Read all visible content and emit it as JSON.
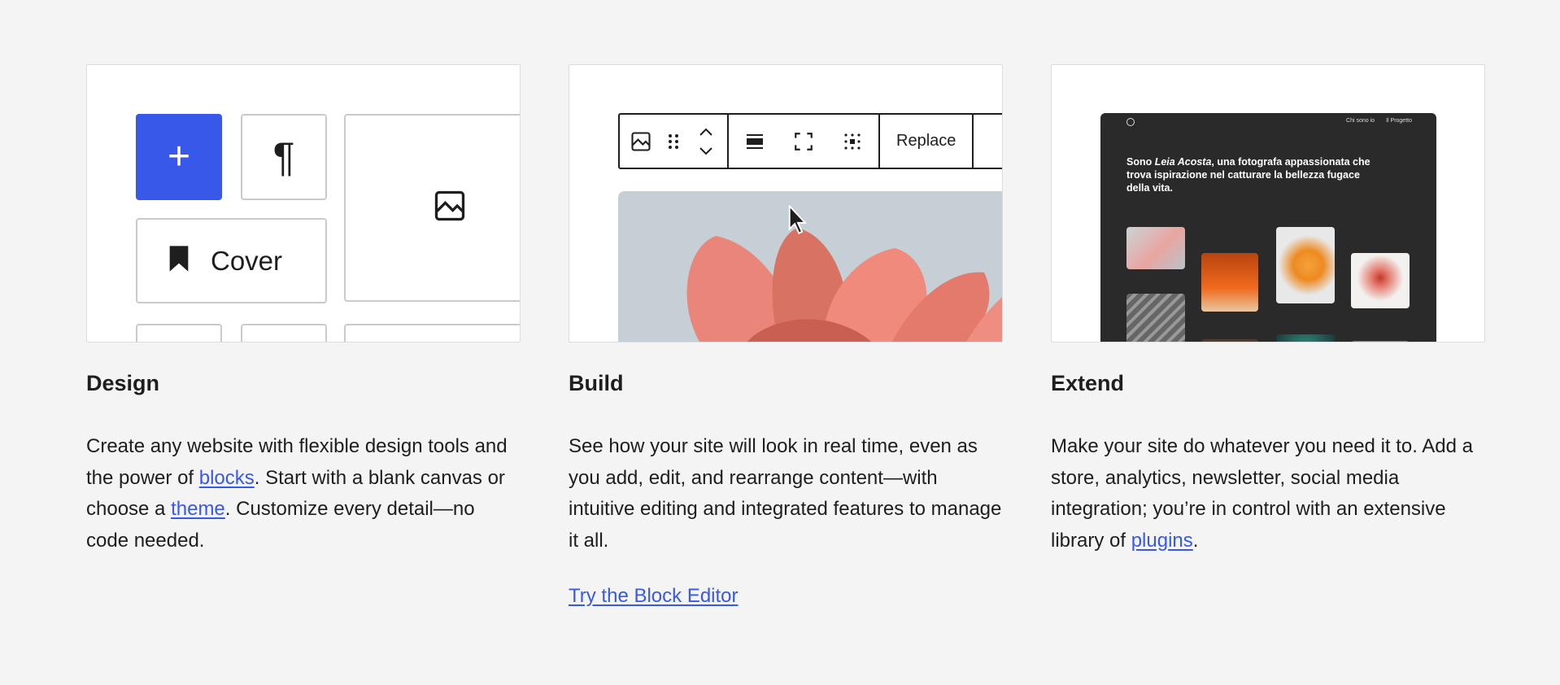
{
  "columns": [
    {
      "heading": "Design",
      "desc": {
        "p1": "Create any website with flexible design tools and the power of ",
        "link1": "blocks",
        "p2": ". Start with a blank canvas or choose a ",
        "link2": "theme",
        "p3": ". Customize every detail—no code needed."
      },
      "preview": {
        "cover_label": "Cover",
        "paragraph_glyph": "¶",
        "plus_glyph": "+",
        "accent": "#3858e9"
      }
    },
    {
      "heading": "Build",
      "desc": "See how your site will look in real time, even as you add, edit, and rearrange content—with intuitive editing and integrated features to manage it all.",
      "cta": "Try the Block Editor",
      "preview": {
        "toolbar_icons": [
          "image-icon",
          "drag-handle-icon",
          "move-up-down-icon",
          "align-icon",
          "fullscreen-icon",
          "grid-icon"
        ],
        "replace_label": "Replace"
      }
    },
    {
      "heading": "Extend",
      "desc": {
        "p1": "Make your site do whatever you need it to. Add a store, analytics, newsletter, social media integration; you’re in control with an extensive library of ",
        "link1": "plugins",
        "p2": "."
      },
      "preview": {
        "nav": [
          "Chi sono io",
          "Il Progetto"
        ],
        "intro": {
          "pre": "Sono ",
          "name": "Leia Acosta",
          "post": ", una fotografa appassionata che trova ispirazione nel catturare la bellezza fugace della vita."
        }
      }
    }
  ]
}
